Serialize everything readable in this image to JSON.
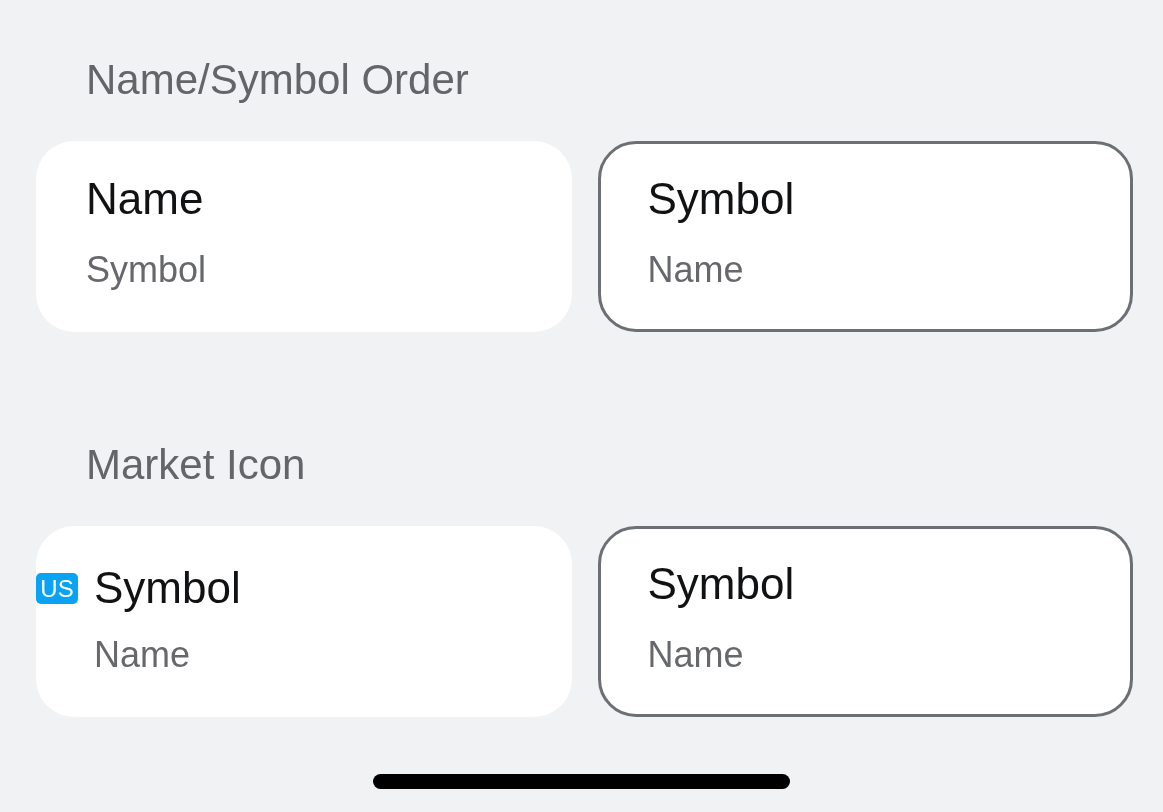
{
  "sections": [
    {
      "label": "Name/Symbol Order",
      "options": [
        {
          "title": "Name",
          "subtitle": "Symbol",
          "selected": false
        },
        {
          "title": "Symbol",
          "subtitle": "Name",
          "selected": true
        }
      ]
    },
    {
      "label": "Market Icon",
      "options": [
        {
          "badge": "US",
          "title": "Symbol",
          "subtitle": "Name",
          "selected": false
        },
        {
          "title": "Symbol",
          "subtitle": "Name",
          "selected": true
        }
      ]
    }
  ]
}
